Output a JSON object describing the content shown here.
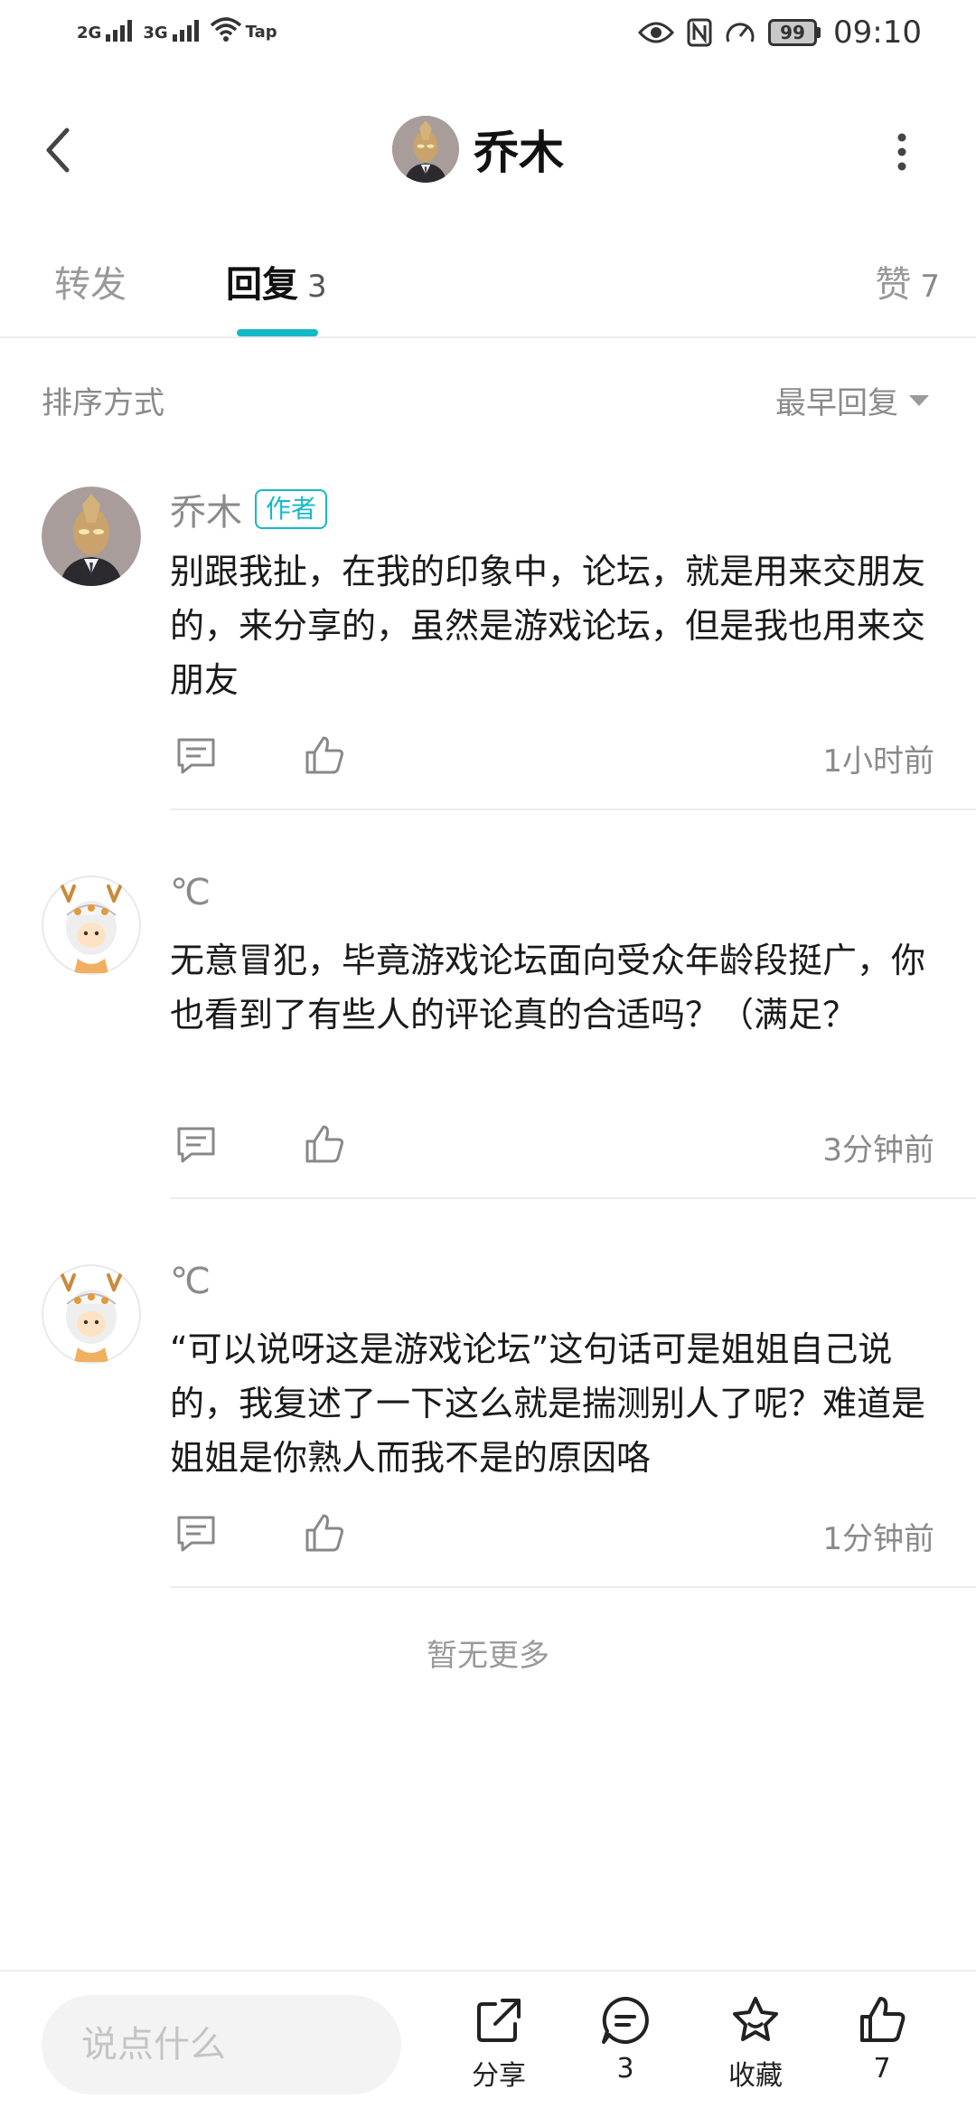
{
  "status_bar": {
    "net1": "2G",
    "net2": "3G",
    "wifi_extra": "Tap",
    "battery": "99",
    "time": "09:10",
    "icons": [
      "eye-icon",
      "nfc-icon",
      "speed-icon"
    ]
  },
  "header": {
    "title": "乔木",
    "back_icon": "chevron-left-icon",
    "more_icon": "more-vertical-icon"
  },
  "tabs": [
    {
      "label": "转发",
      "count": ""
    },
    {
      "label": "回复",
      "count": "3"
    },
    {
      "label": "赞",
      "count": "7"
    }
  ],
  "sort": {
    "label": "排序方式",
    "value": "最早回复"
  },
  "comments": [
    {
      "author": "乔木",
      "badge": "作者",
      "text": "别跟我扯，在我的印象中，论坛，就是用来交朋友的，来分享的，虽然是游戏论坛，但是我也用来交朋友",
      "time": "1小时前"
    },
    {
      "author": "℃",
      "badge": "",
      "text": "无意冒犯，毕竟游戏论坛面向受众年龄段挺广，你也看到了有些人的评论真的合适吗？（满足？",
      "time": "3分钟前"
    },
    {
      "author": "℃",
      "badge": "",
      "text": "“可以说呀这是游戏论坛”这句话可是姐姐自己说的，我复述了一下这么就是揣测别人了呢？难道是姐姐是你熟人而我不是的原因咯",
      "time": "1分钟前"
    }
  ],
  "footer_text": "暂无更多",
  "bottom_bar": {
    "input_placeholder": "说点什么",
    "share_label": "分享",
    "comment_count": "3",
    "favorite_label": "收藏",
    "like_count": "7"
  },
  "colors": {
    "accent": "#14b9c8",
    "muted": "#8a8a8a"
  }
}
